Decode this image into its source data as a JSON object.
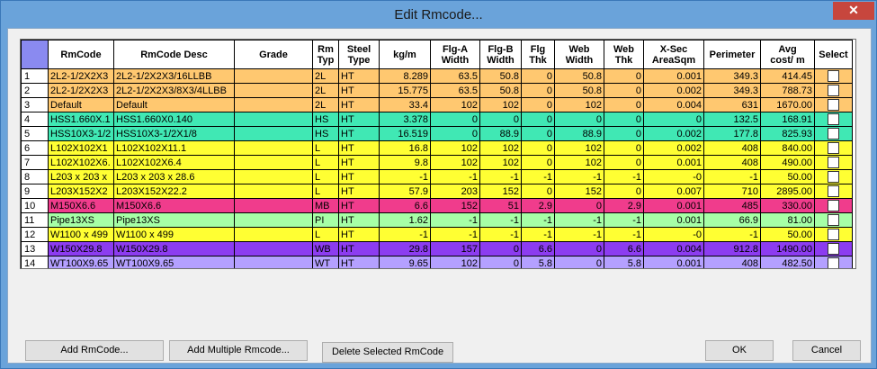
{
  "window": {
    "title": "Edit Rmcode...",
    "close_glyph": "✕"
  },
  "table": {
    "columns": [
      "RmCode",
      "RmCode Desc",
      "Grade",
      "Rm\nTyp",
      "Steel\nType",
      "kg/m",
      "Flg-A\nWidth",
      "Flg-B\nWidth",
      "Flg\nThk",
      "Web\nWidth",
      "Web\nThk",
      "X-Sec\nAreaSqm",
      "Perimeter",
      "Avg\ncost/ m",
      "Select"
    ],
    "rows": [
      {
        "n": "1",
        "color": "#ffc870",
        "cells": [
          "2L2-1/2X2X3",
          "2L2-1/2X2X3/16LLBB",
          "",
          "2L",
          "HT",
          "8.289",
          "63.5",
          "50.8",
          "0",
          "50.8",
          "0",
          "0.001",
          "349.3",
          "414.45"
        ]
      },
      {
        "n": "2",
        "color": "#ffc870",
        "cells": [
          "2L2-1/2X2X3",
          "2L2-1/2X2X3/8X3/4LLBB",
          "",
          "2L",
          "HT",
          "15.775",
          "63.5",
          "50.8",
          "0",
          "50.8",
          "0",
          "0.002",
          "349.3",
          "788.73"
        ]
      },
      {
        "n": "3",
        "color": "#ffc870",
        "cells": [
          "Default",
          "Default",
          "",
          "2L",
          "HT",
          "33.4",
          "102",
          "102",
          "0",
          "102",
          "0",
          "0.004",
          "631",
          "1670.00"
        ]
      },
      {
        "n": "4",
        "color": "#40e8b4",
        "cells": [
          "HSS1.660X.1",
          "HSS1.660X0.140",
          "",
          "HS",
          "HT",
          "3.378",
          "0",
          "0",
          "0",
          "0",
          "0",
          "0",
          "132.5",
          "168.91"
        ]
      },
      {
        "n": "5",
        "color": "#40e8b4",
        "cells": [
          "HSS10X3-1/2",
          "HSS10X3-1/2X1/8",
          "",
          "HS",
          "HT",
          "16.519",
          "0",
          "88.9",
          "0",
          "88.9",
          "0",
          "0.002",
          "177.8",
          "825.93"
        ]
      },
      {
        "n": "6",
        "color": "#ffff33",
        "cells": [
          "L102X102X1",
          "L102X102X11.1",
          "",
          "L",
          "HT",
          "16.8",
          "102",
          "102",
          "0",
          "102",
          "0",
          "0.002",
          "408",
          "840.00"
        ]
      },
      {
        "n": "7",
        "color": "#ffff33",
        "cells": [
          "L102X102X6.",
          "L102X102X6.4",
          "",
          "L",
          "HT",
          "9.8",
          "102",
          "102",
          "0",
          "102",
          "0",
          "0.001",
          "408",
          "490.00"
        ]
      },
      {
        "n": "8",
        "color": "#ffff33",
        "cells": [
          "L203 x 203 x",
          "L203 x 203 x 28.6",
          "",
          "L",
          "HT",
          "-1",
          "-1",
          "-1",
          "-1",
          "-1",
          "-1",
          "-0",
          "-1",
          "50.00"
        ]
      },
      {
        "n": "9",
        "color": "#ffff33",
        "cells": [
          "L203X152X2",
          "L203X152X22.2",
          "",
          "L",
          "HT",
          "57.9",
          "203",
          "152",
          "0",
          "152",
          "0",
          "0.007",
          "710",
          "2895.00"
        ]
      },
      {
        "n": "10",
        "color": "#f03c8c",
        "cells": [
          "M150X6.6",
          "M150X6.6",
          "",
          "MB",
          "HT",
          "6.6",
          "152",
          "51",
          "2.9",
          "0",
          "2.9",
          "0.001",
          "485",
          "330.00"
        ]
      },
      {
        "n": "11",
        "color": "#a6ffa6",
        "cells": [
          "Pipe13XS",
          "Pipe13XS",
          "",
          "PI",
          "HT",
          "1.62",
          "-1",
          "-1",
          "-1",
          "-1",
          "-1",
          "0.001",
          "66.9",
          "81.00"
        ]
      },
      {
        "n": "12",
        "color": "#ffff33",
        "cells": [
          "W1100 x 499",
          "W1100 x 499",
          "",
          "L",
          "HT",
          "-1",
          "-1",
          "-1",
          "-1",
          "-1",
          "-1",
          "-0",
          "-1",
          "50.00"
        ]
      },
      {
        "n": "13",
        "color": "#8c3cf0",
        "cells": [
          "W150X29.8",
          "W150X29.8",
          "",
          "WB",
          "HT",
          "29.8",
          "157",
          "0",
          "6.6",
          "0",
          "6.6",
          "0.004",
          "912.8",
          "1490.00"
        ]
      },
      {
        "n": "14",
        "color": "#b4a0ff",
        "cells": [
          "WT100X9.65",
          "WT100X9.65",
          "",
          "WT",
          "HT",
          "9.65",
          "102",
          "0",
          "5.8",
          "0",
          "5.8",
          "0.001",
          "408",
          "482.50"
        ]
      }
    ]
  },
  "buttons": {
    "add": "Add RmCode...",
    "add_multiple": "Add Multiple Rmcode...",
    "delete": "Delete Selected RmCode",
    "ok": "OK",
    "cancel": "Cancel"
  }
}
